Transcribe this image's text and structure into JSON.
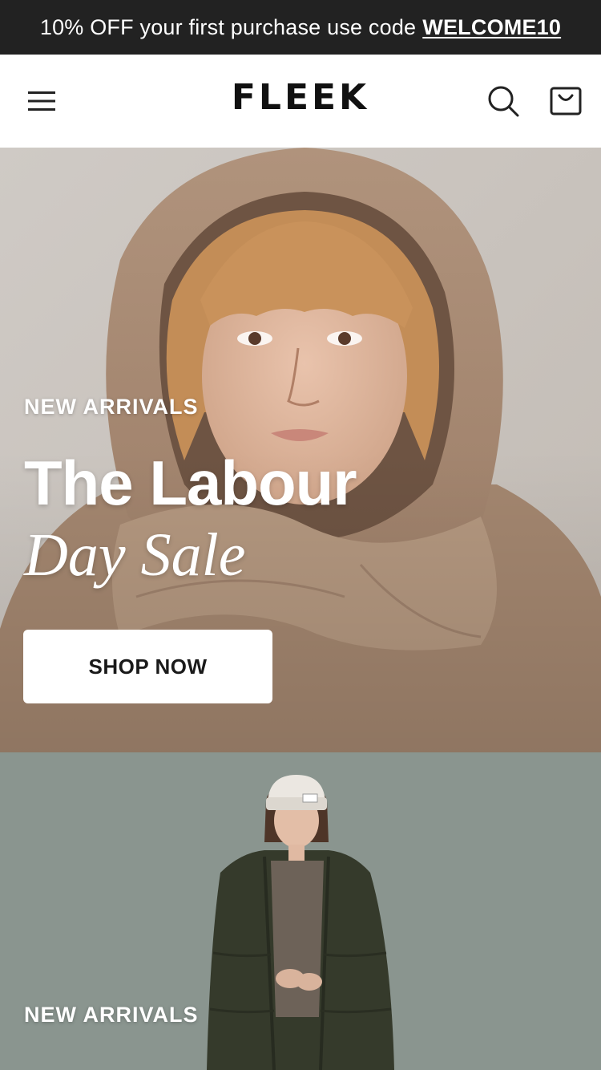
{
  "announcement": {
    "text": "10% OFF your first purchase use code",
    "code": "WELCOME10"
  },
  "header": {
    "logo": "FLEEK",
    "icons": [
      "menu-icon",
      "search-icon",
      "shopping-bag-icon"
    ]
  },
  "hero_primary": {
    "eyebrow": "NEW ARRIVALS",
    "title_line1": "The Labour",
    "title_line2": "Day Sale",
    "cta_label": "SHOP NOW",
    "background_color": "#c9c3bd"
  },
  "hero_secondary": {
    "eyebrow": "NEW ARRIVALS",
    "background_color": "#8a958f"
  },
  "colors": {
    "announcement_bg": "#222222",
    "text_dark": "#111111",
    "hood": "#a88b74"
  }
}
